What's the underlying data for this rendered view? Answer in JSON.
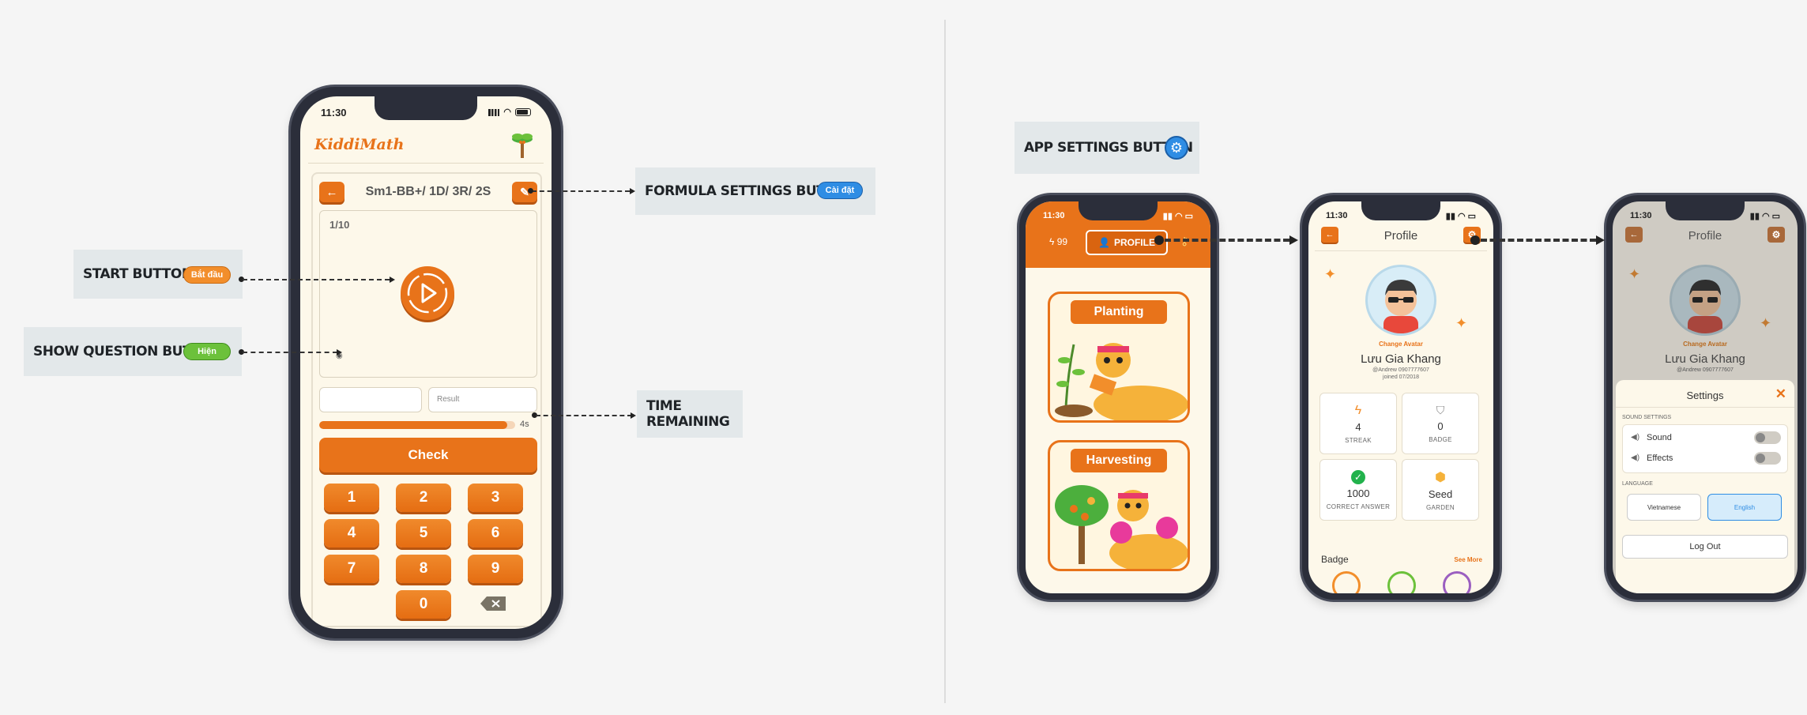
{
  "colors": {
    "accent": "#e8731a",
    "blue": "#2f8de4",
    "green": "#6cc13b",
    "bg": "#f5f5f5"
  },
  "callouts": {
    "formula_settings": {
      "label": "FORMULA SETTINGS BUTTON",
      "pill": "Cài đặt"
    },
    "start": {
      "label": "START BUTTON",
      "pill": "Bắt đầu"
    },
    "show_question": {
      "label": "SHOW QUESTION BUTTON",
      "pill": "Hiện"
    },
    "time_remaining": {
      "label": "TIME REMAINING"
    },
    "app_settings": {
      "label": "APP SETTINGS BUTTON",
      "icon": "gear-icon"
    }
  },
  "game": {
    "time": "11:30",
    "logo": "KiddiMath",
    "formula": "Sm1-BB+/ 1D/ 3R/ 2S",
    "progress": "1/10",
    "result_placeholder": "Result",
    "time_left": "4s",
    "time_fraction": 0.96,
    "check": "Check",
    "keys": [
      "1",
      "2",
      "3",
      "4",
      "5",
      "6",
      "7",
      "8",
      "9",
      "0"
    ]
  },
  "home": {
    "time": "11:30",
    "streak": "99",
    "profile_tab": "PROFILE",
    "cards": [
      "Planting",
      "Harvesting"
    ]
  },
  "profile": {
    "time": "11:30",
    "title": "Profile",
    "change_avatar": "Change Avatar",
    "name": "Lưu Gia Khang",
    "handle": "@Andrew 0907777607",
    "joined": "joined 07/2018",
    "stats": [
      {
        "value": "4",
        "label": "STREAK",
        "icon": "lightning-icon"
      },
      {
        "value": "0",
        "label": "BADGE",
        "icon": "shield-icon"
      },
      {
        "value": "1000",
        "label": "CORRECT ANSWER",
        "icon": "check-circle-icon"
      },
      {
        "value": "Seed",
        "label": "GARDEN",
        "icon": "hexagon-icon"
      }
    ],
    "badge_title": "Badge",
    "see_more": "See More"
  },
  "settings": {
    "time": "11:30",
    "title": "Profile",
    "change_avatar": "Change Avatar",
    "name": "Lưu Gia Khang",
    "handle": "@Andrew 0907777607",
    "panel_title": "Settings",
    "sound_section": "SOUND SETTINGS",
    "sound": "Sound",
    "effects": "Effects",
    "language_section": "LANGUAGE",
    "vietnamese": "Vietnamese",
    "english": "English",
    "logout": "Log Out"
  }
}
